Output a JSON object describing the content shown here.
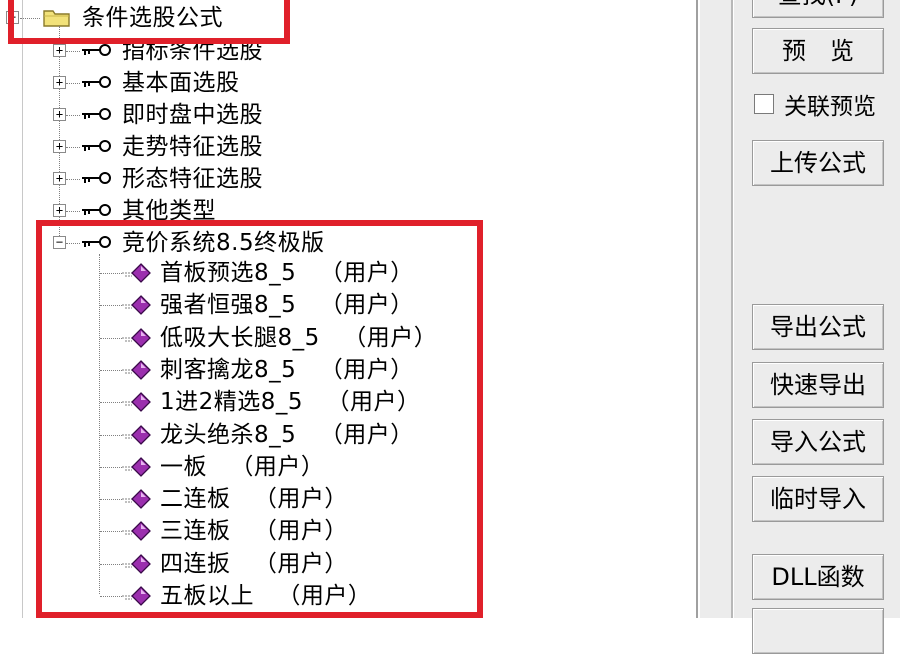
{
  "tree": {
    "root": {
      "label": "条件选股公式",
      "expander": "−"
    },
    "categories": [
      {
        "label": "指标条件选股",
        "expander": "+"
      },
      {
        "label": "基本面选股",
        "expander": "+"
      },
      {
        "label": "即时盘中选股",
        "expander": "+"
      },
      {
        "label": "走势特征选股",
        "expander": "+"
      },
      {
        "label": "形态特征选股",
        "expander": "+"
      },
      {
        "label": "其他类型",
        "expander": "+"
      },
      {
        "label": "竞价系统8.5终极版",
        "expander": "−"
      }
    ],
    "formulas": [
      {
        "label": "首板预选8_5   （用户）"
      },
      {
        "label": "强者恒强8_5   （用户）"
      },
      {
        "label": "低吸大长腿8_5   （用户）"
      },
      {
        "label": "刺客擒龙8_5   （用户）"
      },
      {
        "label": "1进2精选8_5   （用户）"
      },
      {
        "label": "龙头绝杀8_5   （用户）"
      },
      {
        "label": "一板   （用户）"
      },
      {
        "label": "二连板   （用户）"
      },
      {
        "label": "三连板   （用户）"
      },
      {
        "label": "四连扳   （用户）"
      },
      {
        "label": "五板以上   （用户）"
      }
    ]
  },
  "side": {
    "top_cut_button": "查找(F)",
    "preview_button": "预　览",
    "link_preview_checkbox": "关联预览",
    "upload_button": "上传公式",
    "export_button": "导出公式",
    "quick_export_button": "快速导出",
    "import_button": "导入公式",
    "temp_import_button": "临时导入",
    "dll_button": "DLL函数"
  },
  "colors": {
    "highlight": "#e0202a",
    "gem": "#9b2fae",
    "folder": "#f2e27a"
  }
}
